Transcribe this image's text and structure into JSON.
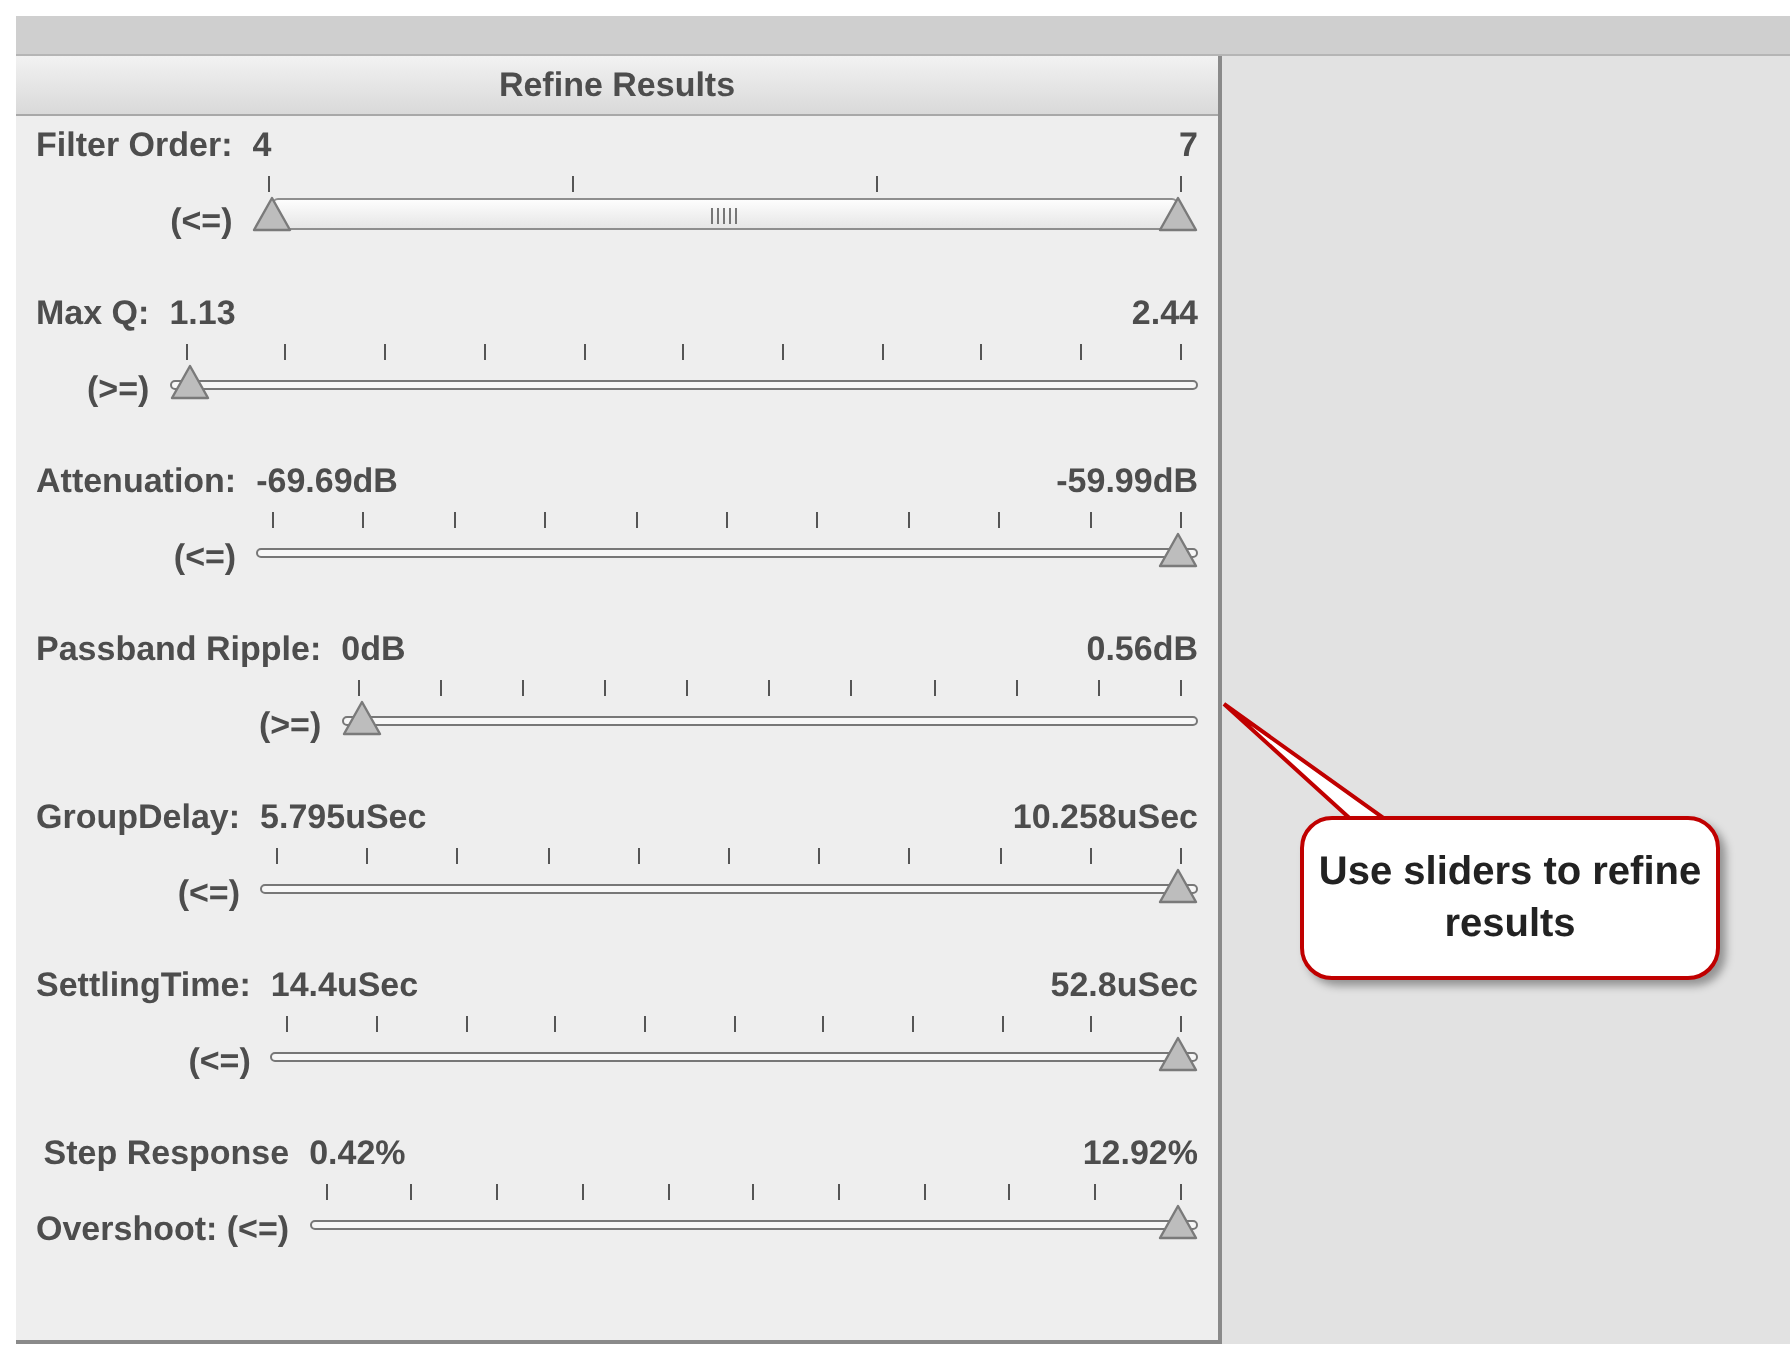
{
  "panel": {
    "title": "Refine Results"
  },
  "sliders": [
    {
      "label": "Filter Order:",
      "min": "4",
      "max": "7",
      "operator": "(<=)",
      "kind": "range",
      "thumbs": [
        {
          "level": 0
        },
        {
          "level": 1
        }
      ]
    },
    {
      "label": "Max Q:",
      "min": "1.13",
      "max": "2.44",
      "operator": "(>=)",
      "kind": "single",
      "thumbs": [
        {
          "level": 0
        }
      ]
    },
    {
      "label": "Attenuation:",
      "min": "-69.69dB",
      "max": "-59.99dB",
      "operator": "(<=)",
      "kind": "single",
      "thumbs": [
        {
          "level": 1
        }
      ]
    },
    {
      "label": "Passband Ripple:",
      "min": "0dB",
      "max": "0.56dB",
      "operator": "(>=)",
      "kind": "single",
      "thumbs": [
        {
          "level": 0
        }
      ]
    },
    {
      "label": "GroupDelay:",
      "min": "5.795uSec",
      "max": "10.258uSec",
      "operator": "(<=)",
      "kind": "single",
      "thumbs": [
        {
          "level": 1
        }
      ]
    },
    {
      "label": "SettlingTime:",
      "min": "14.4uSec",
      "max": "52.8uSec",
      "operator": "(<=)",
      "kind": "single",
      "thumbs": [
        {
          "level": 1
        }
      ]
    },
    {
      "label": "Step Response",
      "min": "0.42%",
      "max": "12.92%",
      "operator": "Overshoot: (<=)",
      "kind": "single",
      "thumbs": [
        {
          "level": 1
        }
      ]
    }
  ],
  "callout": {
    "text": "Use sliders to refine results"
  }
}
